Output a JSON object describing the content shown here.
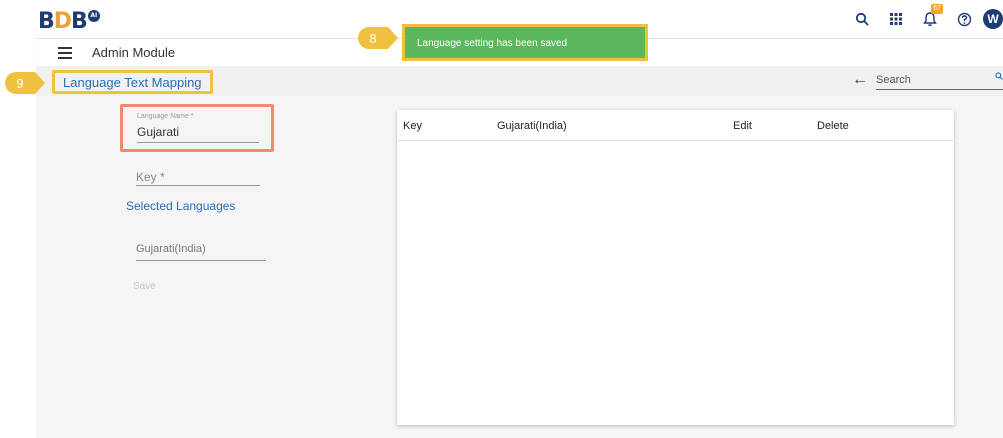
{
  "header": {
    "logo": {
      "part1": "B",
      "part2": "D",
      "part3": "B",
      "ai_badge": "AI"
    },
    "notification_count": "67",
    "avatar_initial": "W"
  },
  "module": {
    "title": "Admin Module"
  },
  "subbar": {
    "page_title": "Language Text Mapping",
    "search_placeholder": "Search"
  },
  "form": {
    "language_name_label": "Language Name *",
    "language_name_value": "Gujarati",
    "key_placeholder": "Key *",
    "selected_languages_heading": "Selected Languages",
    "selected_language_value": "Gujarati(India)",
    "save_label": "Save"
  },
  "table": {
    "columns": [
      "Key",
      "Gujarati(India)",
      "Edit",
      "Delete"
    ],
    "rows": []
  },
  "toast": {
    "message": "Language setting has been saved"
  },
  "callouts": {
    "toast_step": "8",
    "title_step": "9"
  },
  "colors": {
    "accent_blue": "#2a6db5",
    "brand_navy": "#1f3b73",
    "toast_green": "#5cb85c",
    "highlight_yellow": "#f0c040",
    "highlight_orange": "#ee8a6e"
  }
}
